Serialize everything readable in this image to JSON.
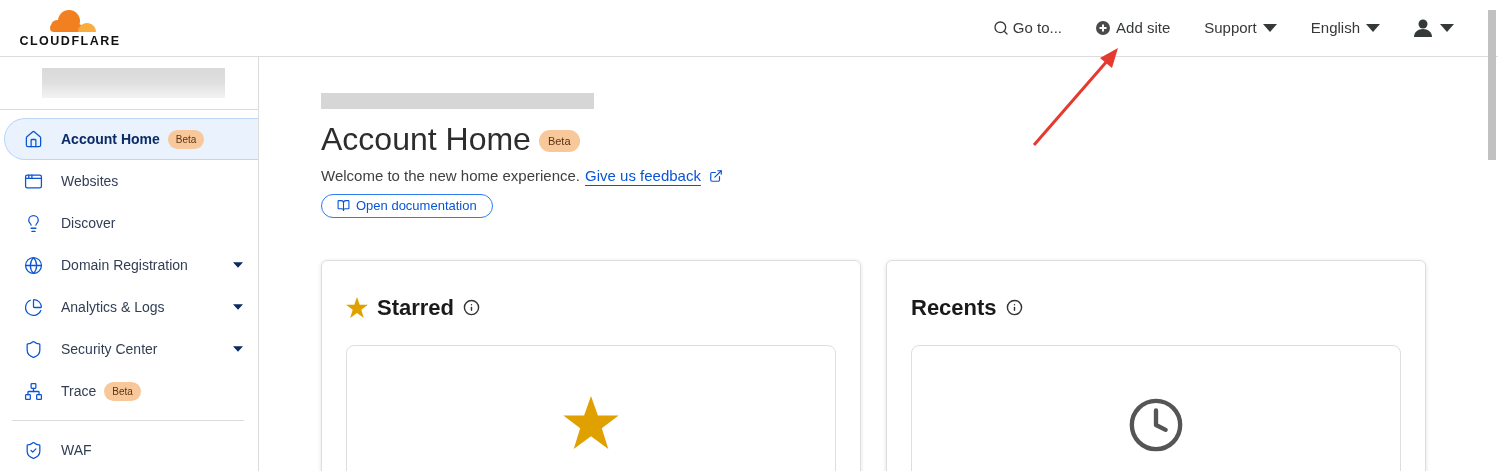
{
  "header": {
    "logo": "CLOUDFLARE",
    "nav": [
      {
        "kind": "search",
        "label": "Go to..."
      },
      {
        "kind": "add",
        "label": "Add site"
      },
      {
        "kind": "menu",
        "label": "Support"
      },
      {
        "kind": "menu",
        "label": "English"
      },
      {
        "kind": "user"
      }
    ]
  },
  "sidebar": {
    "groups": [
      [
        {
          "label": "Account Home",
          "selected": true,
          "badge": "Beta",
          "expandable": false
        },
        {
          "label": "Websites",
          "selected": false,
          "expandable": false
        },
        {
          "label": "Discover",
          "selected": false,
          "expandable": false
        },
        {
          "label": "Domain Registration",
          "selected": false,
          "expandable": true
        },
        {
          "label": "Analytics & Logs",
          "selected": false,
          "expandable": true
        },
        {
          "label": "Security Center",
          "selected": false,
          "expandable": true
        },
        {
          "label": "Trace",
          "selected": false,
          "badge": "Beta",
          "expandable": false
        }
      ],
      [
        {
          "label": "WAF",
          "selected": false,
          "expandable": false
        }
      ]
    ]
  },
  "page": {
    "title": "Account Home",
    "badge": "Beta",
    "welcome": "Welcome to the new home experience.",
    "feedback_link": "Give us feedback",
    "docs_button": "Open documentation",
    "cards": [
      {
        "kind": "starred",
        "title": "Starred"
      },
      {
        "kind": "recents",
        "title": "Recents"
      }
    ]
  }
}
